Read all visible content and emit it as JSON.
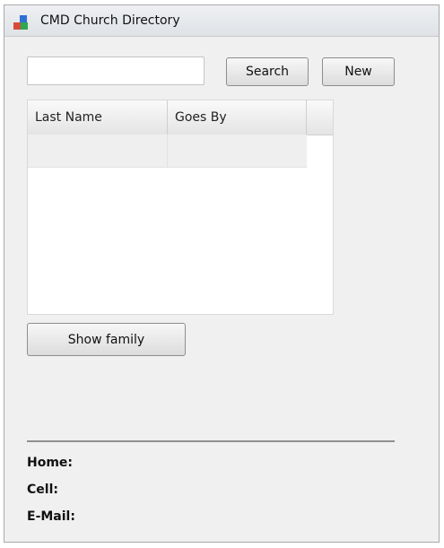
{
  "window": {
    "title": "CMD Church Directory",
    "icon": "app-blocks-icon"
  },
  "search": {
    "value": "",
    "placeholder": "",
    "button_label": "Search"
  },
  "toolbar": {
    "new_label": "New"
  },
  "results_table": {
    "columns": [
      "Last Name",
      "Goes By",
      ""
    ],
    "rows": [
      [
        "",
        ""
      ]
    ]
  },
  "actions": {
    "show_family_label": "Show family"
  },
  "contact": {
    "home_label": "Home:",
    "cell_label": "Cell:",
    "email_label": "E-Mail:"
  },
  "colors": {
    "icon_blue": "#2f6fd6",
    "icon_green": "#2fa84f",
    "icon_red": "#d64b3a"
  }
}
